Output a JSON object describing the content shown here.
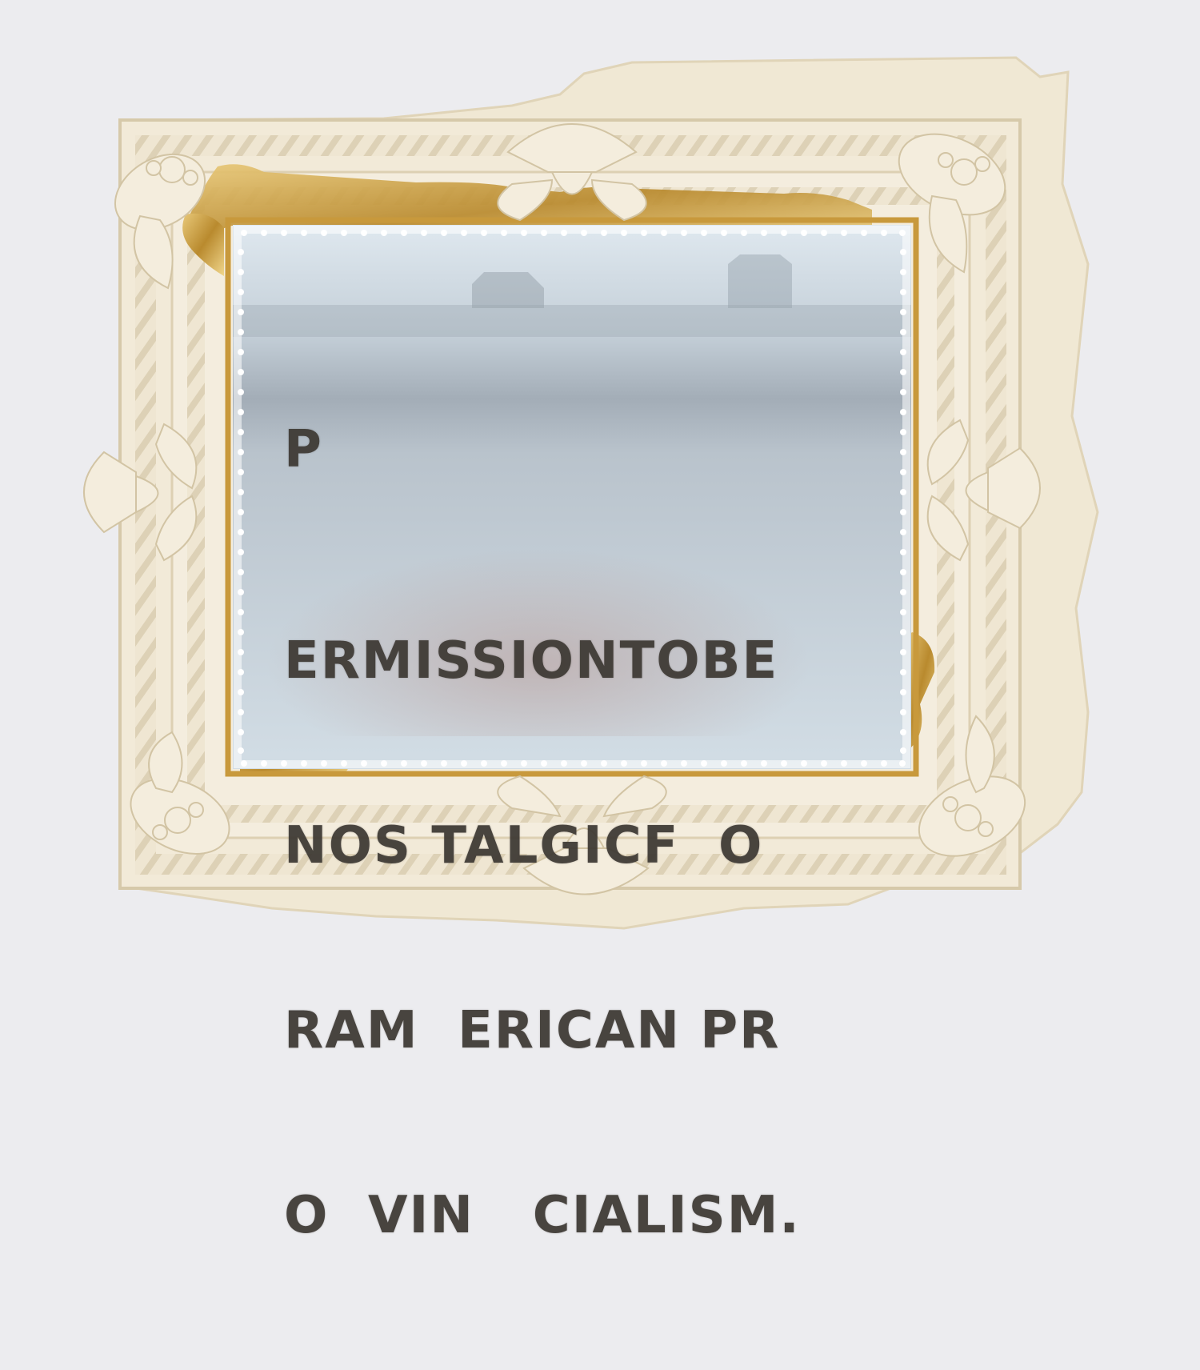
{
  "artwork": {
    "stencil_lines": [
      "P",
      "ERMISSIONTOBE",
      "NOS TALGICF  O",
      "RAM  ERICAN PR",
      "O  VIN   CIALISM."
    ]
  },
  "colors": {
    "wall": "#ececef",
    "frame": "#f1ead9",
    "frame_shadow": "#d8ccb1",
    "gold_leaf": "#c9a04a",
    "led": "#ffffff",
    "glass": "#c7d1da",
    "lettering": "#3e3a34"
  }
}
